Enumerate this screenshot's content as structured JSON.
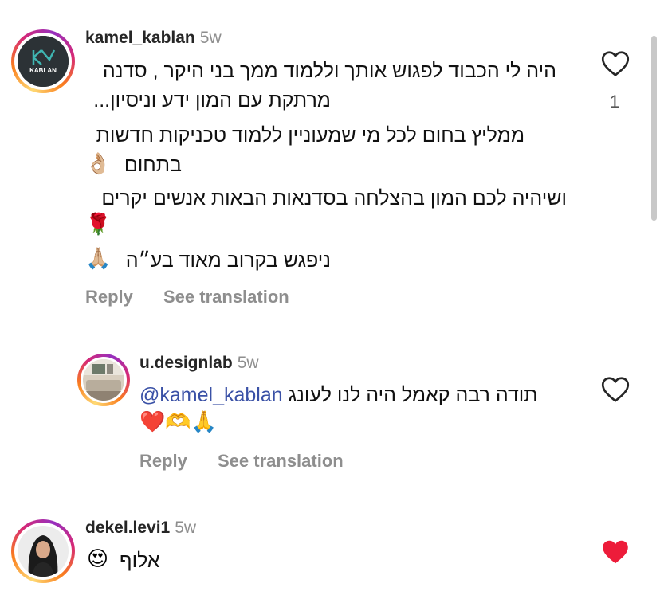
{
  "comments": [
    {
      "username": "kamel_kablan",
      "time": "5w",
      "avatar_label": "KABLAN",
      "lines": [
        "היה לי הכבוד לפגוש אותך וללמוד ממך בני היקר , סדנה",
        "מרתקת עם המון ידע וניסיון...",
        "ממליץ בחום לכל מי שמעוניין ללמוד טכניקות חדשות",
        "בתחום",
        "ושיהיה לכם המון בהצלחה בסדנאות הבאות אנשים יקרים",
        "ניפגש בקרוב מאוד בע״ה"
      ],
      "emojis": [
        "👌🏼",
        "🌹",
        "🙏🏼"
      ],
      "likes": "1",
      "reply_label": "Reply",
      "translate_label": "See translation"
    },
    {
      "username": "u.designlab",
      "time": "5w",
      "mention": "@kamel_kablan",
      "text": "תודה רבה קאמל היה לנו לעונג",
      "emojis": "❤️🫶🙏",
      "reply_label": "Reply",
      "translate_label": "See translation"
    },
    {
      "username": "dekel.levi1",
      "time": "5w",
      "text": "אלוף",
      "emoji": "😍",
      "liked": true
    }
  ],
  "colors": {
    "liked_heart": "#ed1c3a",
    "mention": "#3a51a6",
    "muted": "#8e8e8e"
  },
  "icons": [
    "heart-outline-icon",
    "heart-filled-icon"
  ]
}
